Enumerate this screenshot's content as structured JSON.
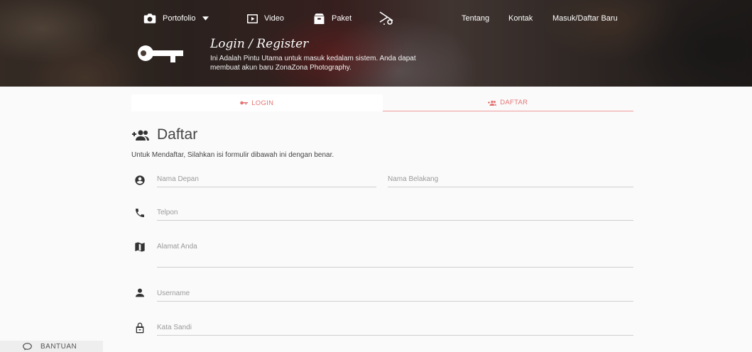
{
  "nav": {
    "portfolio": "Portofolio",
    "video": "Video",
    "paket": "Paket",
    "tentang": "Tentang",
    "kontak": "Kontak",
    "masuk": "Masuk/Daftar Baru"
  },
  "hero": {
    "title": "Login / Register",
    "subtitle": "Ini Adalah Pintu Utama untuk masuk kedalam sistem. Anda dapat membuat akun baru ZonaZona Photography."
  },
  "tabs": {
    "login": "LOGIN",
    "daftar": "DAFTAR"
  },
  "form": {
    "title": "Daftar",
    "description": "Untuk Mendaftar, Silahkan isi formulir dibawah ini dengan benar.",
    "first_name_placeholder": "Nama Depan",
    "last_name_placeholder": "Nama Belakang",
    "phone_placeholder": "Telpon",
    "address_placeholder": "Alamat Anda",
    "username_placeholder": "Username",
    "password_placeholder": "Kata Sandi"
  },
  "help": {
    "label": "BANTUAN"
  },
  "colors": {
    "accent": "#e57373",
    "background": "#fafafa"
  }
}
